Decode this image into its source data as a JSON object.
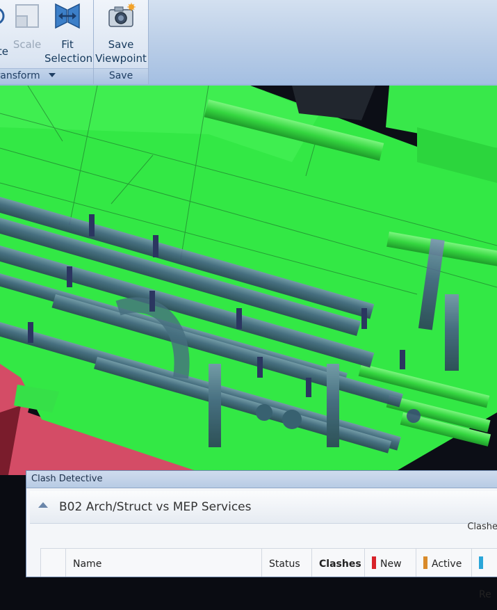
{
  "ribbon": {
    "transform_group": {
      "footer": "Transform",
      "buttons": [
        {
          "label": "Rotate",
          "icon": "rotate-icon",
          "enabled": true
        },
        {
          "label": "Scale",
          "icon": "scale-icon",
          "enabled": false
        },
        {
          "label": "Fit Selection",
          "line1": "Fit",
          "line2": "Selection",
          "icon": "fit-selection-icon",
          "enabled": true
        }
      ]
    },
    "save_group": {
      "footer": "Save",
      "buttons": [
        {
          "label": "Save Viewpoint",
          "line1": "Save",
          "line2": "Viewpoint",
          "icon": "camera-save-icon"
        }
      ]
    }
  },
  "viewport": {
    "description_colors": {
      "clash_green": "#33e845",
      "clash_red": "#e0556e",
      "pipe_blue": "#4a5a8a"
    }
  },
  "clash_detective": {
    "title": "Clash Detective",
    "test_name": "B02 Arch/Struct vs MEP Services",
    "clashes_label": "Clashe",
    "columns": [
      {
        "label": "",
        "key": "select"
      },
      {
        "label": "Name",
        "key": "name"
      },
      {
        "label": "Status",
        "key": "status"
      },
      {
        "label": "Clashes",
        "key": "clashes"
      },
      {
        "label": "New",
        "key": "new",
        "color": "#d8232a"
      },
      {
        "label": "Active",
        "key": "active",
        "color": "#d98a2a"
      },
      {
        "label": "Re",
        "key": "reviewed",
        "color": "#2aa6d9"
      }
    ]
  },
  "colors": {
    "ribbon_text": "#15395c",
    "new": "#d8232a",
    "active": "#d98a2a",
    "reviewed": "#2aa6d9"
  }
}
